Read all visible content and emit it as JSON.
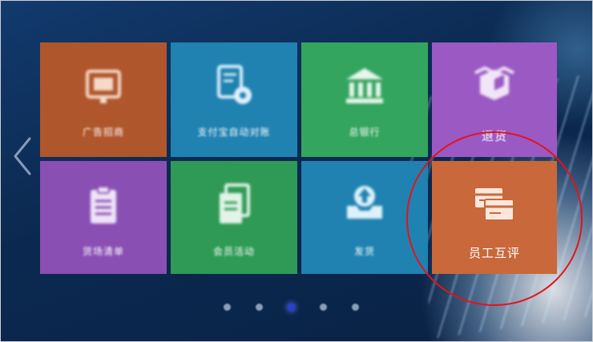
{
  "tiles": [
    {
      "label": "广告招商",
      "icon": "monitor-icon",
      "color": "#b0562c"
    },
    {
      "label": "支付宝自动对账",
      "icon": "document-gear-icon",
      "color": "#1f82b1"
    },
    {
      "label": "总银行",
      "icon": "bank-icon",
      "color": "#33a55e"
    },
    {
      "label": "退货",
      "icon": "box-return-icon",
      "color": "#9b59c4"
    },
    {
      "label": "货场清单",
      "icon": "clipboard-icon",
      "color": "#8a4fb3"
    },
    {
      "label": "会员活动",
      "icon": "copy-document-icon",
      "color": "#2f9a55"
    },
    {
      "label": "发货",
      "icon": "inbox-upload-icon",
      "color": "#1f82b1"
    },
    {
      "label": "员工互评",
      "icon": "cards-icon",
      "color": "#c9683b"
    }
  ],
  "pagination": {
    "total": 5,
    "active": 3
  },
  "highlight": {
    "target": "员工互评",
    "color": "#e0141b"
  }
}
